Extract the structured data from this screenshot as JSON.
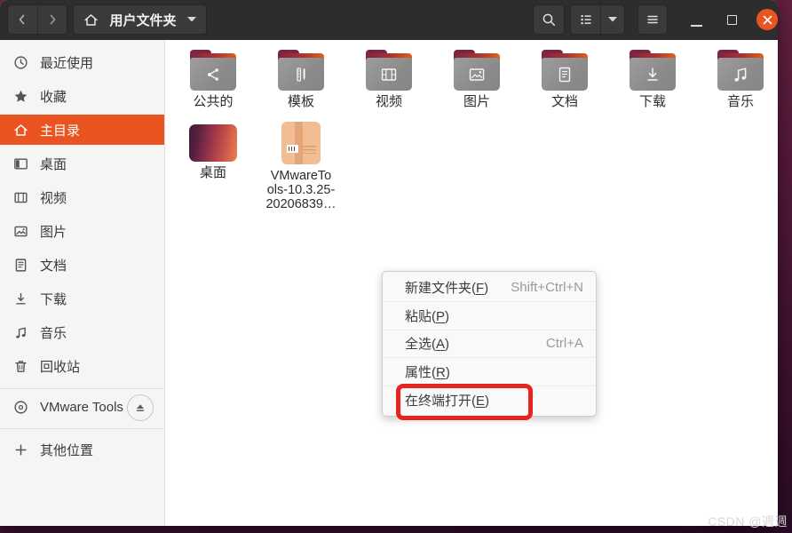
{
  "titlebar": {
    "path_label": "用户文件夹"
  },
  "sidebar": {
    "items": [
      {
        "label": "最近使用",
        "icon": "clock-icon"
      },
      {
        "label": "收藏",
        "icon": "star-icon"
      },
      {
        "label": "主目录",
        "icon": "home-icon",
        "selected": true
      },
      {
        "label": "桌面",
        "icon": "desktop-icon"
      },
      {
        "label": "视频",
        "icon": "film-icon"
      },
      {
        "label": "图片",
        "icon": "image-icon"
      },
      {
        "label": "文档",
        "icon": "document-icon"
      },
      {
        "label": "下载",
        "icon": "download-icon"
      },
      {
        "label": "音乐",
        "icon": "music-icon"
      },
      {
        "label": "回收站",
        "icon": "trash-icon"
      }
    ],
    "device": {
      "label": "VMware Tools",
      "icon": "disc-icon",
      "eject": true
    },
    "other": {
      "label": "其他位置",
      "icon": "plus-icon"
    }
  },
  "files": {
    "row1": [
      {
        "label": "公共的",
        "emblem": "share"
      },
      {
        "label": "模板",
        "emblem": "template"
      },
      {
        "label": "视频",
        "emblem": "film"
      },
      {
        "label": "图片",
        "emblem": "image"
      },
      {
        "label": "文档",
        "emblem": "document"
      },
      {
        "label": "下载",
        "emblem": "download"
      },
      {
        "label": "音乐",
        "emblem": "music"
      }
    ],
    "row2": [
      {
        "label": "桌面",
        "type": "desktop-folder"
      },
      {
        "label": "VMwareTo\nols-10.3.25-\n20206839…",
        "type": "package-file"
      }
    ]
  },
  "context_menu": {
    "items": [
      {
        "text": "新建文件夹(",
        "key": "F",
        "close": ")",
        "shortcut": "Shift+Ctrl+N"
      },
      {
        "text": "粘贴(",
        "key": "P",
        "close": ")",
        "shortcut": ""
      },
      {
        "text": "全选(",
        "key": "A",
        "close": ")",
        "shortcut": "Ctrl+A"
      },
      {
        "text": "属性(",
        "key": "R",
        "close": ")",
        "shortcut": ""
      },
      {
        "text": "在终端打开(",
        "key": "E",
        "close": ")",
        "shortcut": ""
      }
    ]
  },
  "annotation": {
    "shape": "red-rectangle",
    "color": "#e8241f",
    "target": "在终端打开(E)"
  },
  "watermark": "CSDN @週週",
  "colors": {
    "accent_orange": "#E95420",
    "titlebar_bg": "#2d2d2d",
    "sidebar_bg": "#f6f5f4",
    "desktop_wallpaper_top": "#6e2746",
    "desktop_wallpaper_bottom": "#2a0b26",
    "folder_flap": "#7d2443",
    "folder_body": "#8f8f8f"
  }
}
